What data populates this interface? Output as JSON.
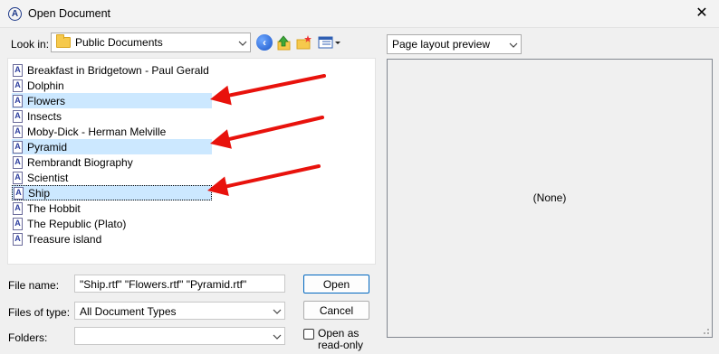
{
  "window": {
    "title": "Open Document",
    "close_glyph": "✕",
    "app_icon_letter": "A"
  },
  "toolbar": {
    "look_in_label": "Look in:",
    "look_in_value": "Public Documents",
    "icons": [
      "back-icon",
      "up-one-level-icon",
      "new-folder-icon",
      "view-menu-icon"
    ]
  },
  "files": [
    {
      "name": "Breakfast in Bridgetown - Paul Gerald",
      "selected": false
    },
    {
      "name": "Dolphin",
      "selected": false
    },
    {
      "name": "Flowers",
      "selected": true
    },
    {
      "name": "Insects",
      "selected": false
    },
    {
      "name": "Moby-Dick - Herman Melville",
      "selected": false
    },
    {
      "name": "Pyramid",
      "selected": true
    },
    {
      "name": "Rembrandt Biography",
      "selected": false
    },
    {
      "name": "Scientist",
      "selected": false
    },
    {
      "name": "Ship",
      "selected": true,
      "focused": true
    },
    {
      "name": "The Hobbit",
      "selected": false
    },
    {
      "name": "The Republic (Plato)",
      "selected": false
    },
    {
      "name": "Treasure island",
      "selected": false
    }
  ],
  "form": {
    "file_name_label": "File name:",
    "file_name_value": "\"Ship.rtf\" \"Flowers.rtf\" \"Pyramid.rtf\"",
    "files_of_type_label": "Files of type:",
    "files_of_type_value": "All Document Types",
    "folders_label": "Folders:",
    "folders_value": "",
    "open_button": "Open",
    "cancel_button": "Cancel",
    "read_only_label_line1": "Open as",
    "read_only_label_line2": "read-only",
    "read_only_checked": false
  },
  "preview": {
    "mode_value": "Page layout preview",
    "content_text": "(None)"
  },
  "annotations": {
    "arrow_color": "#e8120c"
  },
  "colors": {
    "selection": "#cce8ff",
    "accent": "#0067c0"
  }
}
